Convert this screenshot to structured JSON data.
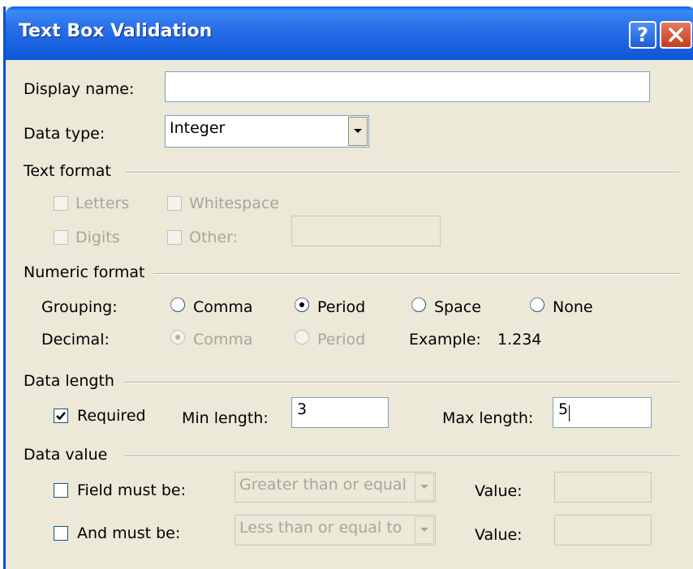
{
  "window": {
    "title": "Text Box Validation",
    "help_glyph": "?",
    "icons": {
      "help": "help-icon",
      "close": "close-icon"
    }
  },
  "display_name": {
    "label": "Display name:",
    "value": ""
  },
  "data_type": {
    "label": "Data type:",
    "selected": "Integer"
  },
  "text_format": {
    "heading": "Text format",
    "letters": {
      "label": "Letters",
      "checked": false,
      "enabled": false
    },
    "whitespace": {
      "label": "Whitespace",
      "checked": false,
      "enabled": false
    },
    "digits": {
      "label": "Digits",
      "checked": false,
      "enabled": false
    },
    "other": {
      "label": "Other:",
      "checked": false,
      "enabled": false,
      "value": ""
    }
  },
  "numeric_format": {
    "heading": "Numeric format",
    "grouping_label": "Grouping:",
    "grouping": {
      "comma": "Comma",
      "period": "Period",
      "space": "Space",
      "none": "None",
      "selected": "Period"
    },
    "decimal_label": "Decimal:",
    "decimal": {
      "comma": "Comma",
      "period": "Period",
      "selected": "Comma",
      "enabled": false
    },
    "example_label": "Example:",
    "example_value": "1.234"
  },
  "data_length": {
    "heading": "Data length",
    "required_label": "Required",
    "required_checked": true,
    "min_label": "Min length:",
    "min_value": "3",
    "max_label": "Max length:",
    "max_value": "5"
  },
  "data_value": {
    "heading": "Data value",
    "field_must_be_label": "Field must be:",
    "field_must_be_checked": false,
    "field_operator": "Greater than or equal",
    "field_value_label": "Value:",
    "field_value": "",
    "and_must_be_label": "And must be:",
    "and_must_be_checked": false,
    "and_operator": "Less than or equal to",
    "and_value_label": "Value:",
    "and_value": ""
  },
  "colors": {
    "titlebar": "#0d56d6",
    "dialog_bg": "#ece9d8",
    "disabled_text": "#a9a699",
    "close_button": "#c73c1e"
  }
}
